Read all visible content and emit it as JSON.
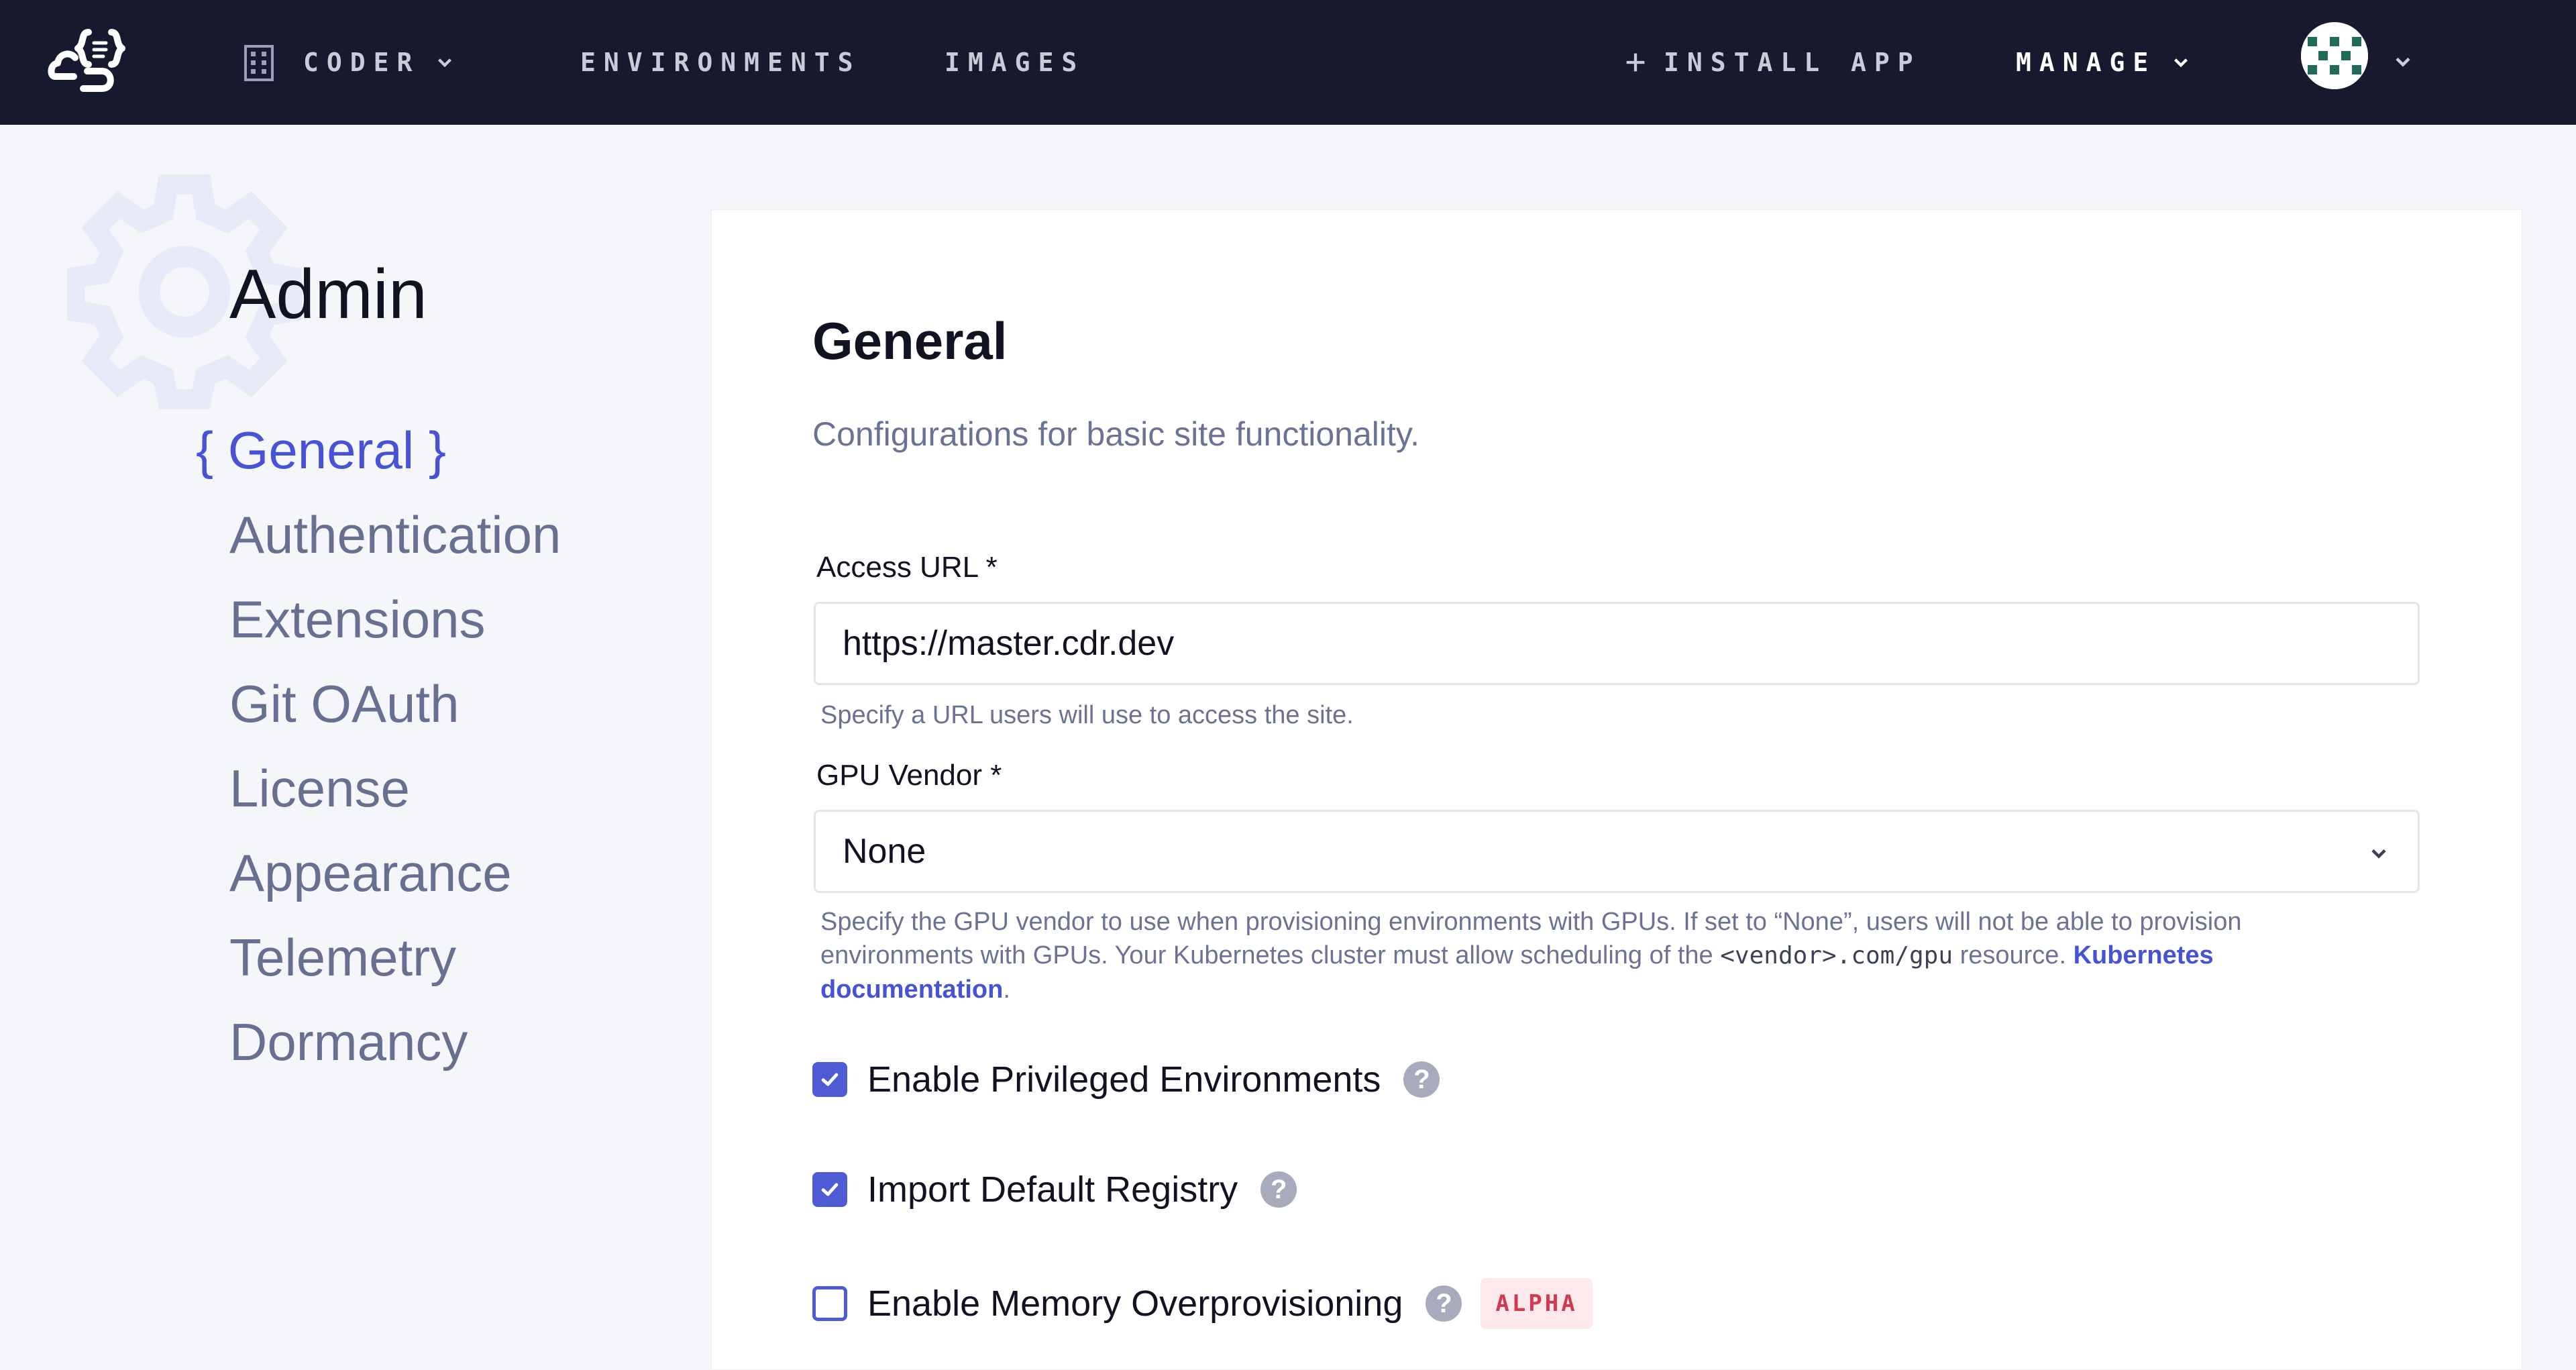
{
  "nav": {
    "org_label": "CODER",
    "environments_label": "ENVIRONMENTS",
    "images_label": "IMAGES",
    "install_app_label": "INSTALL APP",
    "manage_label": "MANAGE"
  },
  "sidebar": {
    "title": "Admin",
    "items": [
      {
        "label": "General",
        "active": true
      },
      {
        "label": "Authentication"
      },
      {
        "label": "Extensions"
      },
      {
        "label": "Git OAuth"
      },
      {
        "label": "License"
      },
      {
        "label": "Appearance"
      },
      {
        "label": "Telemetry"
      },
      {
        "label": "Dormancy"
      }
    ]
  },
  "main": {
    "title": "General",
    "description": "Configurations for basic site functionality.",
    "access_url": {
      "label": "Access URL *",
      "value": "https://master.cdr.dev",
      "help": "Specify a URL users will use to access the site."
    },
    "gpu_vendor": {
      "label": "GPU Vendor *",
      "value": "None",
      "help_prefix": "Specify the GPU vendor to use when provisioning environments with GPUs. If set to “None”, users will not be able to provision environments with GPUs. Your Kubernetes cluster must allow scheduling of the",
      "help_code": "<vendor>.com/gpu",
      "help_suffix": "resource.",
      "help_link": "Kubernetes documentation",
      "help_end": "."
    },
    "checkboxes": [
      {
        "label": "Enable Privileged Environments",
        "checked": true
      },
      {
        "label": "Import Default Registry",
        "checked": true
      },
      {
        "label": "Enable Memory Overprovisioning",
        "checked": false,
        "badge": "ALPHA"
      }
    ]
  },
  "colors": {
    "topbar": "#171a2e",
    "accent": "#4752d6",
    "badge_bg": "#fde8ec",
    "badge_text": "#d23a52"
  }
}
